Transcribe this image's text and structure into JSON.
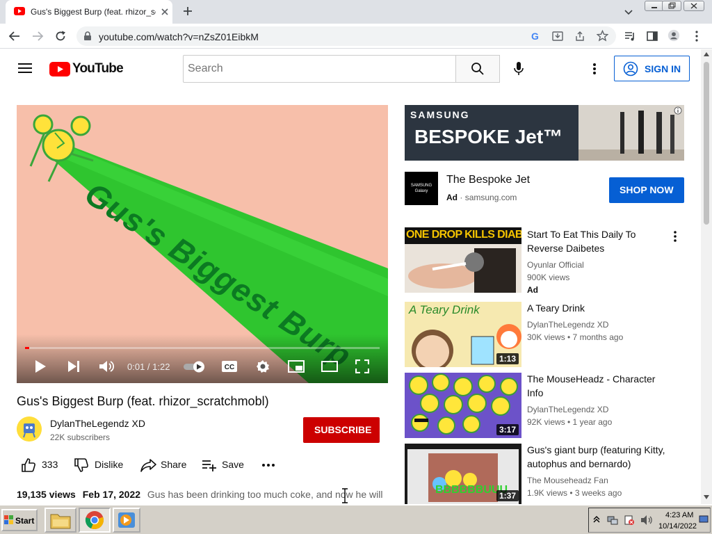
{
  "browser": {
    "tab_title": "Gus's Biggest Burp (feat. rhizor_scra",
    "url": "youtube.com/watch?v=nZsZ01EibkM"
  },
  "youtube": {
    "logo_text": "YouTube",
    "search_placeholder": "Search",
    "signin_label": "SIGN IN"
  },
  "player": {
    "overlay_text": "Gus's Biggest Burp",
    "time": "0:01 / 1:22",
    "progress": 0.012
  },
  "video": {
    "title": "Gus's Biggest Burp (feat. rhizor_scratchmobl)",
    "channel": "DylanTheLegendz XD",
    "subscribers": "22K subscribers",
    "subscribe_label": "SUBSCRIBE",
    "likes": "333",
    "dislike_label": "Dislike",
    "share_label": "Share",
    "save_label": "Save",
    "views": "19,135 views",
    "date": "Feb 17, 2022",
    "description": "Gus has been drinking too much coke, and now he will"
  },
  "ad": {
    "banner_brand": "SAMSUNG",
    "banner_title": "BESPOKE Jet™",
    "logo_text": "SAMSUNG Galaxy",
    "title": "The Bespoke Jet",
    "badge": "Ad",
    "domain": "samsung.com",
    "cta": "SHOP NOW"
  },
  "recommendations": [
    {
      "title": "Start To Eat This Daily To Reverse Daibetes",
      "channel": "Oyunlar Official",
      "meta": "900K views",
      "badge": "Ad",
      "thumb_text": "ONE DROP KILLS DIABETES",
      "duration": ""
    },
    {
      "title": "A Teary Drink",
      "channel": "DylanTheLegendz XD",
      "meta": "30K views • 7 months ago",
      "badge": "",
      "thumb_text": "A Teary Drink",
      "duration": "1:13"
    },
    {
      "title": "The MouseHeadz - Character Info",
      "channel": "DylanTheLegendz XD",
      "meta": "92K views • 1 year ago",
      "badge": "",
      "thumb_text": "",
      "duration": "3:17"
    },
    {
      "title": "Gus's giant burp (featuring Kitty, autophus and bernardo)",
      "channel": "The Mouseheadz Fan",
      "meta": "1.9K views • 3 weeks ago",
      "badge": "",
      "thumb_text": "BBBBBBUUU",
      "duration": "1:37"
    }
  ],
  "taskbar": {
    "start_label": "Start",
    "time": "4:23 AM",
    "date": "10/14/2022"
  },
  "colors": {
    "youtube_red": "#ff0000",
    "subscribe_red": "#cc0000",
    "link_blue": "#065fd4",
    "video_bg": "#f7bfaa",
    "beam_green": "#2fc52f"
  }
}
